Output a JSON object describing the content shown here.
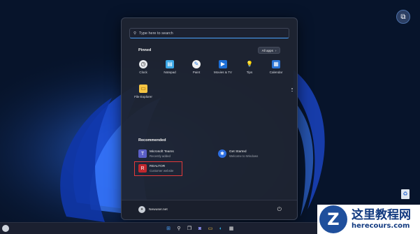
{
  "search": {
    "placeholder": "Type here to search"
  },
  "pinned": {
    "label": "Pinned",
    "all_apps": "All apps",
    "apps": [
      {
        "label": "Clock",
        "icon": "clock-icon"
      },
      {
        "label": "Notepad",
        "icon": "notepad-icon"
      },
      {
        "label": "Paint",
        "icon": "paint-icon"
      },
      {
        "label": "Movies & TV",
        "icon": "movies-icon"
      },
      {
        "label": "Tips",
        "icon": "tips-icon"
      },
      {
        "label": "Calendar",
        "icon": "calendar-icon"
      },
      {
        "label": "File Explorer",
        "icon": "folder-icon"
      }
    ]
  },
  "recommended": {
    "label": "Recommended",
    "items": [
      {
        "title": "Microsoft Teams",
        "subtitle": "Recently added",
        "icon": "teams-icon"
      },
      {
        "title": "Get Started",
        "subtitle": "Welcome to Windows",
        "icon": "get-started-icon"
      },
      {
        "title": "REALTOR",
        "subtitle": "Customer website",
        "icon": "realtor-icon"
      }
    ]
  },
  "footer": {
    "user_name": "Newuser.net"
  },
  "watermark": {
    "line1": "这里教程网",
    "line2": "herecours.com"
  },
  "colors": {
    "accent": "#4aa3ff",
    "highlight": "#e23a3a",
    "wallpaper": "#07142b"
  }
}
